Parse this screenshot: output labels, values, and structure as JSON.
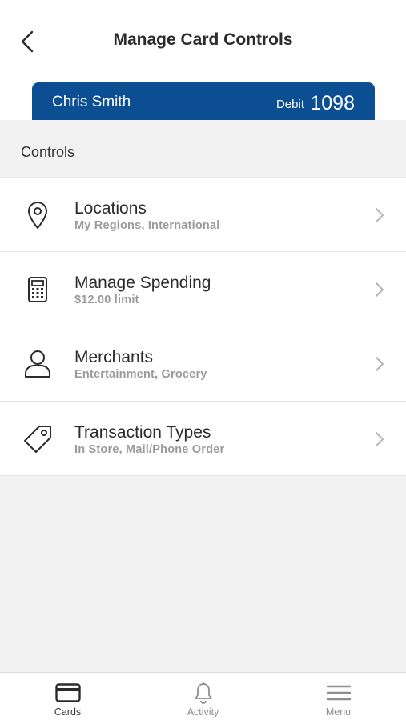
{
  "header": {
    "title": "Manage Card Controls",
    "back_icon": "chevron-left-icon"
  },
  "card": {
    "holder_name": "Chris Smith",
    "type": "Debit",
    "last4": "1098",
    "color": "#0b4f92"
  },
  "section": {
    "label": "Controls"
  },
  "controls": [
    {
      "title": "Locations",
      "subtitle": "My Regions, International",
      "icon": "location-pin-icon"
    },
    {
      "title": "Manage Spending",
      "subtitle": "$12.00 limit",
      "icon": "calculator-icon"
    },
    {
      "title": "Merchants",
      "subtitle": "Entertainment, Grocery",
      "icon": "person-icon"
    },
    {
      "title": "Transaction Types",
      "subtitle": "In Store, Mail/Phone Order",
      "icon": "tag-icon"
    }
  ],
  "tabbar": {
    "tabs": [
      {
        "label": "Cards",
        "icon": "card-icon",
        "active": true
      },
      {
        "label": "Activity",
        "icon": "bell-icon",
        "active": false
      },
      {
        "label": "Menu",
        "icon": "hamburger-icon",
        "active": false
      }
    ]
  }
}
